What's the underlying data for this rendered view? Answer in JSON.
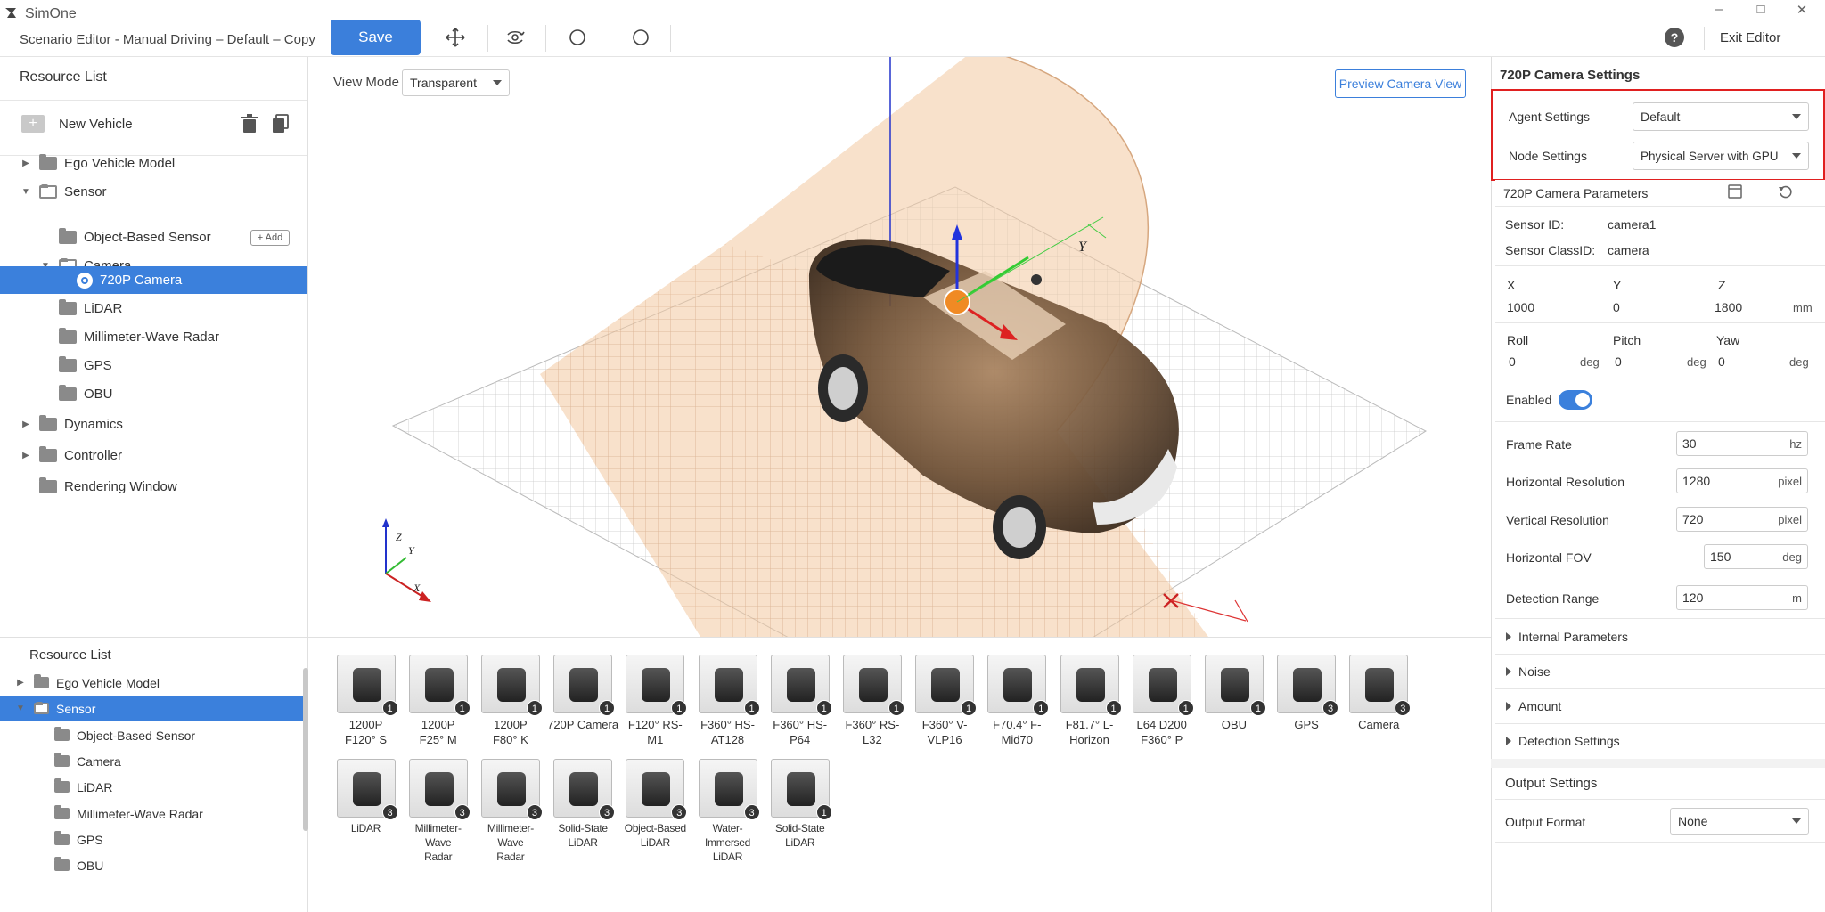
{
  "app": {
    "name": "SimOne",
    "doc_title": "Scenario Editor - Manual Driving – Default – Copy"
  },
  "toolbar": {
    "save_label": "Save",
    "help_icon": "?",
    "exit_label": "Exit Editor"
  },
  "window_controls": {
    "minimize": "–",
    "maximize": "□",
    "close": "✕"
  },
  "left_panel": {
    "title": "Resource List",
    "new_vehicle_label": "New Vehicle",
    "tree": {
      "ego": "Ego Vehicle Model",
      "sensor": "Sensor",
      "object_based": "Object-Based Sensor",
      "add_label": "+ Add",
      "camera": "Camera",
      "cam720": "720P Camera",
      "lidar": "LiDAR",
      "mmw": "Millimeter-Wave Radar",
      "gps": "GPS",
      "obu": "OBU",
      "dynamics": "Dynamics",
      "controller": "Controller",
      "rendering": "Rendering Window"
    }
  },
  "bottom_left": {
    "title": "Resource List",
    "items": {
      "ego": "Ego Vehicle Model",
      "sensor": "Sensor",
      "object_based": "Object-Based Sensor",
      "camera": "Camera",
      "lidar": "LiDAR",
      "mmw": "Millimeter-Wave Radar",
      "gps": "GPS",
      "obu": "OBU"
    }
  },
  "viewport": {
    "view_mode_label": "View Mode",
    "view_mode_value": "Transparent",
    "preview_label": "Preview Camera View",
    "axis_labels": {
      "z": "Z",
      "y": "Y",
      "x": "X",
      "gizmo_y": "Y"
    }
  },
  "gallery": {
    "row1": [
      {
        "l1": "1200P",
        "l2": "F120° S",
        "badge": "1"
      },
      {
        "l1": "1200P",
        "l2": "F25° M",
        "badge": "1"
      },
      {
        "l1": "1200P",
        "l2": "F80° K",
        "badge": "1"
      },
      {
        "l1": "720P Camera",
        "l2": "",
        "badge": "1"
      },
      {
        "l1": "F120° RS-",
        "l2": "M1",
        "badge": "1"
      },
      {
        "l1": "F360° HS-",
        "l2": "AT128",
        "badge": "1"
      },
      {
        "l1": "F360° HS-",
        "l2": "P64",
        "badge": "1"
      },
      {
        "l1": "F360° RS-",
        "l2": "L32",
        "badge": "1"
      },
      {
        "l1": "F360° V-",
        "l2": "VLP16",
        "badge": "1"
      },
      {
        "l1": "F70.4° F-",
        "l2": "Mid70",
        "badge": "1"
      },
      {
        "l1": "F81.7° L-",
        "l2": "Horizon",
        "badge": "1"
      },
      {
        "l1": "L64 D200",
        "l2": "F360° P",
        "badge": "1"
      },
      {
        "l1": "OBU",
        "l2": "",
        "badge": "1"
      },
      {
        "l1": "GPS",
        "l2": "",
        "badge": "3"
      },
      {
        "l1": "Camera",
        "l2": "",
        "badge": "3"
      }
    ],
    "row2": [
      {
        "l1": "LiDAR",
        "l2": "",
        "badge": "3"
      },
      {
        "l1": "Millimeter-Wave",
        "l2": "Radar",
        "badge": "3"
      },
      {
        "l1": "Millimeter-Wave",
        "l2": "Radar",
        "badge": "3"
      },
      {
        "l1": "Solid-State",
        "l2": "LiDAR",
        "badge": "3"
      },
      {
        "l1": "Object-Based",
        "l2": "LiDAR",
        "badge": "3"
      },
      {
        "l1": "Water-Immersed",
        "l2": "LiDAR",
        "badge": "3"
      },
      {
        "l1": "Solid-State",
        "l2": "LiDAR",
        "badge": "1"
      }
    ]
  },
  "right_panel": {
    "title": "720P Camera Settings",
    "agent_settings_label": "Agent Settings",
    "agent_settings_value": "Default",
    "node_settings_label": "Node Settings",
    "node_settings_value": "Physical Server with GPU",
    "params_title": "720P Camera Parameters",
    "sensor_id_label": "Sensor ID:",
    "sensor_id_value": "camera1",
    "sensor_class_label": "Sensor ClassID:",
    "sensor_class_value": "camera",
    "x_label": "X",
    "y_label": "Y",
    "z_label": "Z",
    "x_value": "1000",
    "y_value": "0",
    "z_value": "1800",
    "pos_unit": "mm",
    "roll_label": "Roll",
    "pitch_label": "Pitch",
    "yaw_label": "Yaw",
    "roll_value": "0",
    "pitch_value": "0",
    "yaw_value": "0",
    "deg_unit": "deg",
    "enabled_label": "Enabled",
    "frame_rate_label": "Frame Rate",
    "frame_rate_value": "30",
    "frame_rate_unit": "hz",
    "hres_label": "Horizontal Resolution",
    "hres_value": "1280",
    "hres_unit": "pixel",
    "vres_label": "Vertical Resolution",
    "vres_value": "720",
    "vres_unit": "pixel",
    "hfov_label": "Horizontal FOV",
    "hfov_value": "150",
    "hfov_unit": "deg",
    "range_label": "Detection Range",
    "range_value": "120",
    "range_unit": "m",
    "internal_params": "Internal Parameters",
    "noise": "Noise",
    "amount": "Amount",
    "detection_settings": "Detection Settings",
    "output_settings": "Output Settings",
    "output_format_label": "Output Format",
    "output_format_value": "None"
  },
  "colors": {
    "accent": "#3b80dc",
    "highlight_box": "#e02020",
    "frustum": "#f3c9a0"
  }
}
